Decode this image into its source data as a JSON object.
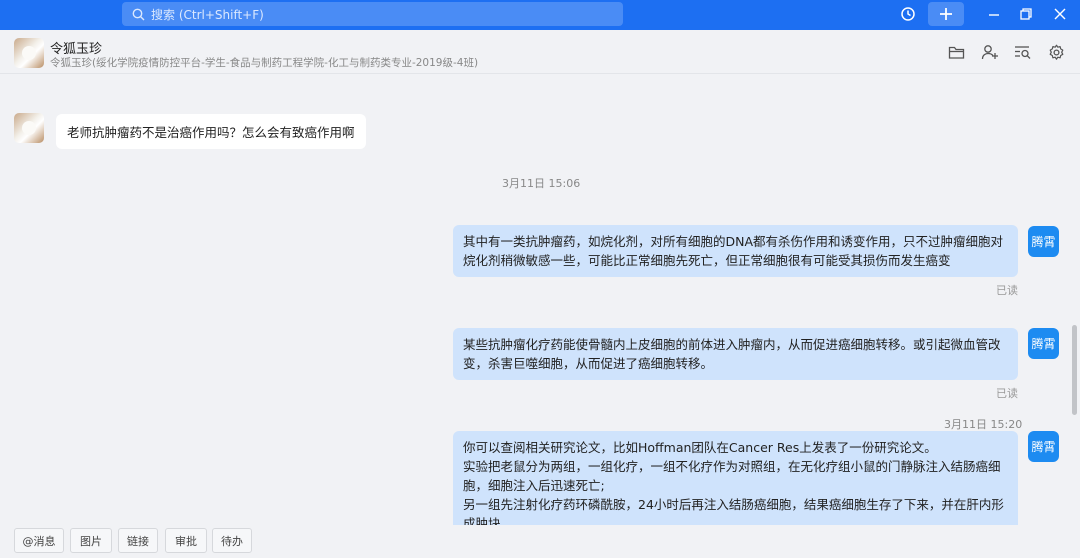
{
  "topbar": {
    "search_placeholder": "搜索 (Ctrl+Shift+F)",
    "icons": [
      "history-icon",
      "plus-icon",
      "minimize-icon",
      "maximize-icon",
      "close-icon"
    ]
  },
  "chat": {
    "contact_name": "令狐玉珍",
    "contact_detail": "令狐玉珍(绥化学院疫情防控平台-学生-食品与制药工程学院-化工与制药类专业-2019级-4班)",
    "header_icons": [
      "folder-icon",
      "add-user-icon",
      "search-record-icon",
      "settings-icon"
    ]
  },
  "messages": {
    "incoming_1": "老师抗肿瘤药不是治癌作用吗？怎么会有致癌作用啊",
    "time_1": "3月11日 15:06",
    "outgoing_1_line1": "其中有一类抗肿瘤药，如烷化剂，对所有细胞的DNA都有杀伤作用和诱变作用，只不过肿瘤细胞对",
    "outgoing_1_line2": "烷化剂稍微敏感一些，可能比正常细胞先死亡，但正常细胞很有可能受其损伤而发生癌变",
    "read_1": "已读",
    "outgoing_2_line1": "某些抗肿瘤化疗药能使骨髓内上皮细胞的前体进入肿瘤内，从而促进癌细胞转移。或引起微血管改",
    "outgoing_2_line2": "变，杀害巨噬细胞，从而促进了癌细胞转移。",
    "read_2": "已读",
    "time_2": "3月11日 15:20",
    "outgoing_3_line1": "你可以查阅相关研究论文，比如Hoffman团队在Cancer Res上发表了一份研究论文。",
    "outgoing_3_line2": "实验把老鼠分为两组，一组化疗，一组不化疗作为对照组，在无化疗组小鼠的门静脉注入结肠癌细",
    "outgoing_3_line3": "胞，细胞注入后迅速死亡;",
    "outgoing_3_line4": "另一组先注射化疗药环磷酰胺，24小时后再注入结肠癌细胞，结果癌细胞生存了下来，并在肝内形",
    "outgoing_3_line5": "成肿块",
    "sender_badge": "腾霄"
  },
  "bottombar": {
    "btn_mention": "@消息",
    "btn_image": "图片",
    "btn_link": "链接",
    "btn_approval": "审批",
    "btn_todo": "待办"
  },
  "colors": {
    "topbar": "#1d6ff2",
    "bubble_out": "#cfe3fc",
    "badge": "#1d8bf1"
  }
}
